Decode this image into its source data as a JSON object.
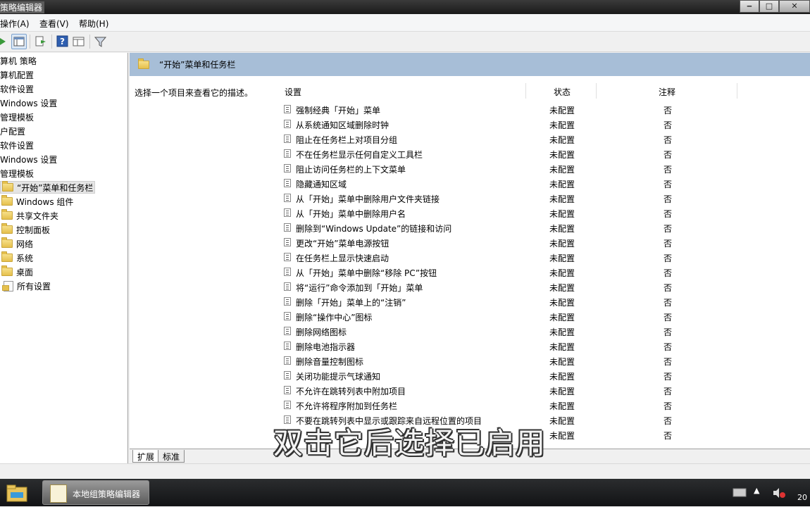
{
  "window": {
    "title": "策略编辑器"
  },
  "menu": [
    {
      "label": "操作(A)"
    },
    {
      "label": "查看(V)"
    },
    {
      "label": "帮助(H)"
    }
  ],
  "tree": [
    {
      "label": "算机 策略",
      "folder": false
    },
    {
      "label": "算机配置",
      "folder": false
    },
    {
      "label": "软件设置",
      "folder": false
    },
    {
      "label": "Windows 设置",
      "folder": false
    },
    {
      "label": "管理模板",
      "folder": false
    },
    {
      "label": "户配置",
      "folder": false
    },
    {
      "label": "软件设置",
      "folder": false
    },
    {
      "label": "Windows 设置",
      "folder": false
    },
    {
      "label": "管理模板",
      "folder": false
    },
    {
      "label": "“开始”菜单和任务栏",
      "folder": true,
      "selected": true
    },
    {
      "label": "Windows 组件",
      "folder": true
    },
    {
      "label": "共享文件夹",
      "folder": true
    },
    {
      "label": "控制面板",
      "folder": true
    },
    {
      "label": "网络",
      "folder": true
    },
    {
      "label": "系统",
      "folder": true
    },
    {
      "label": "桌面",
      "folder": true
    },
    {
      "label": "所有设置",
      "folder": false,
      "special": true
    }
  ],
  "right": {
    "header_title": "“开始”菜单和任务栏",
    "description": "选择一个项目来查看它的描述。",
    "columns": {
      "setting": "设置",
      "state": "状态",
      "comment": "注释"
    },
    "rows": [
      {
        "name": "强制经典「开始」菜单",
        "state": "未配置",
        "comment": "否"
      },
      {
        "name": "从系统通知区域删除时钟",
        "state": "未配置",
        "comment": "否"
      },
      {
        "name": "阻止在任务栏上对项目分组",
        "state": "未配置",
        "comment": "否"
      },
      {
        "name": "不在任务栏显示任何自定义工具栏",
        "state": "未配置",
        "comment": "否"
      },
      {
        "name": "阻止访问任务栏的上下文菜单",
        "state": "未配置",
        "comment": "否"
      },
      {
        "name": "隐藏通知区域",
        "state": "未配置",
        "comment": "否"
      },
      {
        "name": "从「开始」菜单中删除用户文件夹链接",
        "state": "未配置",
        "comment": "否"
      },
      {
        "name": "从「开始」菜单中删除用户名",
        "state": "未配置",
        "comment": "否"
      },
      {
        "name": "删除到“Windows Update”的链接和访问",
        "state": "未配置",
        "comment": "否"
      },
      {
        "name": "更改“开始”菜单电源按钮",
        "state": "未配置",
        "comment": "否"
      },
      {
        "name": "在任务栏上显示快速启动",
        "state": "未配置",
        "comment": "否"
      },
      {
        "name": "从「开始」菜单中删除“移除 PC”按钮",
        "state": "未配置",
        "comment": "否"
      },
      {
        "name": "将“运行”命令添加到「开始」菜单",
        "state": "未配置",
        "comment": "否"
      },
      {
        "name": "删除「开始」菜单上的“注销”",
        "state": "未配置",
        "comment": "否"
      },
      {
        "name": "删除“操作中心”图标",
        "state": "未配置",
        "comment": "否"
      },
      {
        "name": "删除网络图标",
        "state": "未配置",
        "comment": "否"
      },
      {
        "name": "删除电池指示器",
        "state": "未配置",
        "comment": "否"
      },
      {
        "name": "删除音量控制图标",
        "state": "未配置",
        "comment": "否"
      },
      {
        "name": "关闭功能提示气球通知",
        "state": "未配置",
        "comment": "否"
      },
      {
        "name": "不允许在跳转列表中附加项目",
        "state": "未配置",
        "comment": "否"
      },
      {
        "name": "不允许将程序附加到任务栏",
        "state": "未配置",
        "comment": "否"
      },
      {
        "name": "不要在跳转列表中显示或跟踪来自远程位置的项目",
        "state": "未配置",
        "comment": "否"
      },
      {
        "name": "",
        "state": "未配置",
        "comment": "否"
      }
    ]
  },
  "tabs": [
    {
      "label": "扩展"
    },
    {
      "label": "标准"
    }
  ],
  "subtitle": "双击它后选择已启用",
  "taskbar": {
    "item_label": "本地组策略编辑器",
    "clock_partial": "20"
  },
  "icons": {
    "folder": "folder-icon",
    "policy": "policy-setting-icon",
    "filter": "filter-icon",
    "help": "help-icon"
  }
}
